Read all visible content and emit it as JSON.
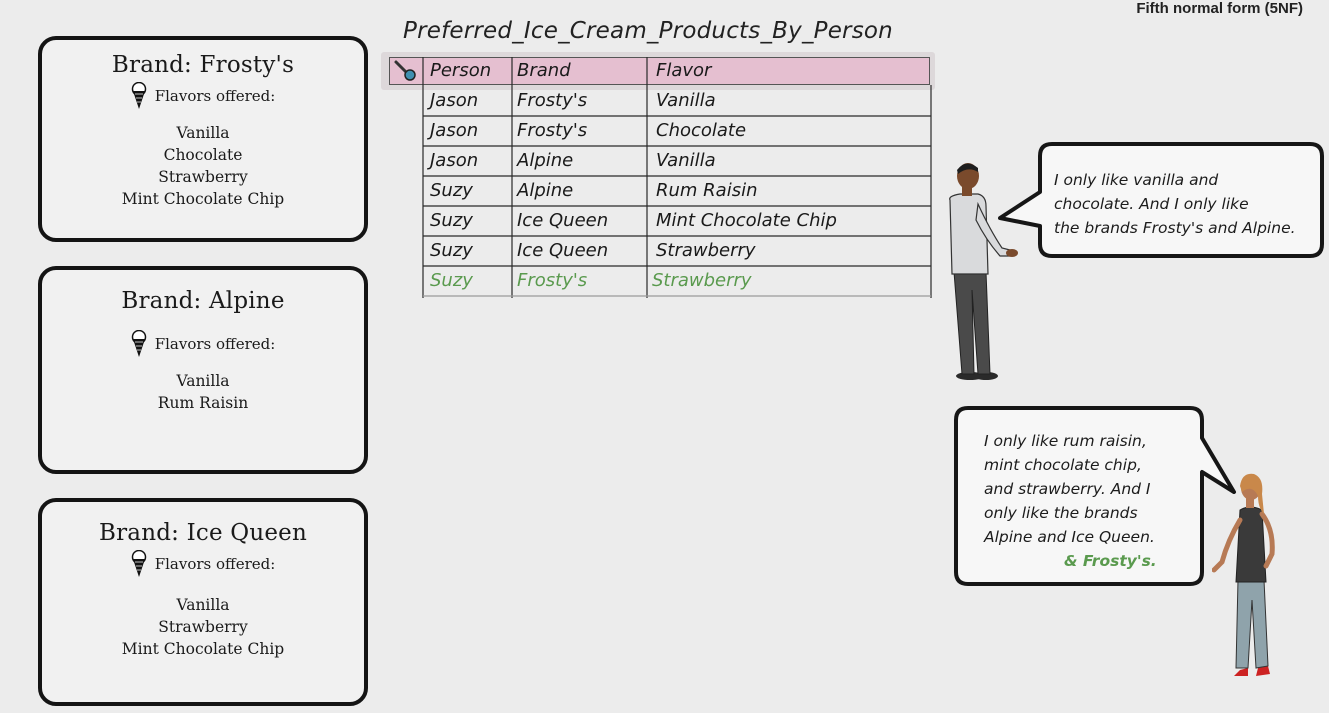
{
  "header": {
    "title": "Fifth normal form (5NF)"
  },
  "brands": [
    {
      "title": "Brand: Frosty's",
      "flavors_label": "Flavors offered:",
      "flavors": [
        "Vanilla",
        "Chocolate",
        "Strawberry",
        "Mint Chocolate Chip"
      ]
    },
    {
      "title": "Brand: Alpine",
      "flavors_label": "Flavors offered:",
      "flavors": [
        "Vanilla",
        "Rum Raisin"
      ]
    },
    {
      "title": "Brand: Ice Queen",
      "flavors_label": "Flavors offered:",
      "flavors": [
        "Vanilla",
        "Strawberry",
        "Mint Chocolate Chip"
      ]
    }
  ],
  "table": {
    "title": "Preferred_Ice_Cream_Products_By_Person",
    "columns": [
      "Person",
      "Brand",
      "Flavor"
    ],
    "rows": [
      [
        "Jason",
        "Frosty's",
        "Vanilla"
      ],
      [
        "Jason",
        "Frosty's",
        "Chocolate"
      ],
      [
        "Jason",
        "Alpine",
        "Vanilla"
      ],
      [
        "Suzy",
        "Alpine",
        "Rum Raisin"
      ],
      [
        "Suzy",
        "Ice Queen",
        "Mint Chocolate Chip"
      ],
      [
        "Suzy",
        "Ice Queen",
        "Strawberry"
      ]
    ],
    "highlight_row": [
      "Suzy",
      "Frosty's",
      "Strawberry"
    ],
    "highlight_color": "#5a9a4e",
    "header_color": "#e5bfd0",
    "key_icon": "key-icon"
  },
  "speech": {
    "jason": [
      "I only like vanilla and",
      "chocolate. And I only like",
      "the brands Frosty's and Alpine."
    ],
    "suzy": [
      "I only like rum raisin,",
      "mint chocolate chip,",
      "and strawberry. And I",
      "only like the brands",
      "Alpine and Ice Queen."
    ],
    "suzy_addition": "& Frosty's."
  }
}
